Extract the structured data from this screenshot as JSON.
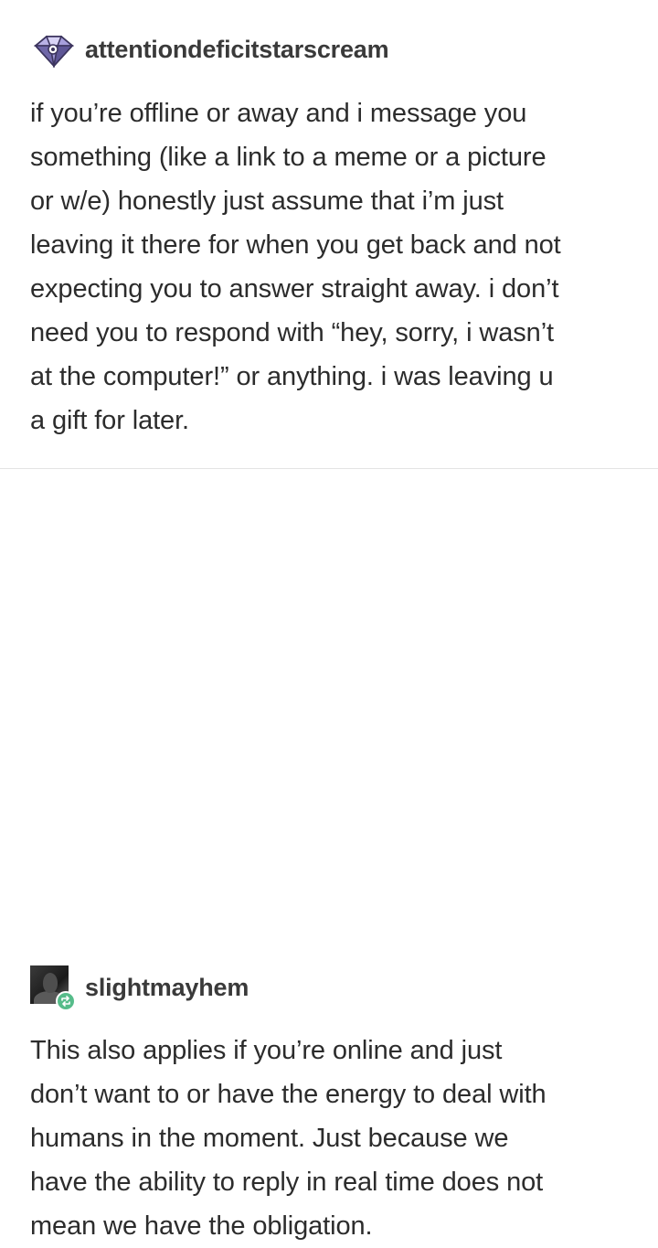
{
  "posts": [
    {
      "username": "attentiondeficitstarscream",
      "avatar_icon": "gem-icon",
      "lines": [
        "if you’re offline or away and i message you",
        "something (like a link to a meme or a picture",
        "or w/e) honestly just assume that i’m just",
        "leaving it there for when you get back and not",
        "expecting you to answer straight away. i don’t",
        "need you to respond with “hey, sorry, i wasn’t",
        "at the computer!” or anything. i was leaving u",
        "a gift for later."
      ]
    },
    {
      "username": "slightmayhem",
      "avatar_icon": "user-photo",
      "badge_icon": "reblog-icon",
      "badge_color": "#56bc8a",
      "lines": [
        "This also applies if you’re online and just",
        "don’t want to or have the energy to deal with",
        "humans in the moment.  Just because we",
        "have the ability to reply in real time does not",
        "mean we have the obligation."
      ]
    }
  ]
}
